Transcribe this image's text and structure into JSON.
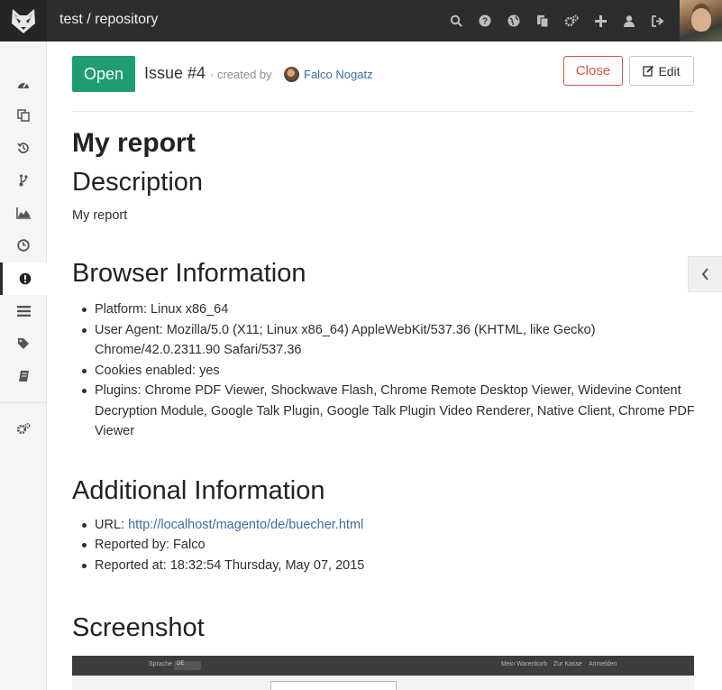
{
  "header": {
    "repo_title": "test / repository",
    "icons": [
      "search-icon",
      "help-icon",
      "globe-icon",
      "copy-icon",
      "cogs-icon",
      "plus-icon",
      "user-icon",
      "sign-out-icon"
    ]
  },
  "sidebar": {
    "items": [
      {
        "name": "dashboard-icon"
      },
      {
        "name": "files-icon"
      },
      {
        "name": "history-icon"
      },
      {
        "name": "branch-icon"
      },
      {
        "name": "graphs-icon"
      },
      {
        "name": "clock-icon"
      },
      {
        "name": "issues-icon",
        "active": true
      },
      {
        "name": "list-icon"
      },
      {
        "name": "tags-icon"
      },
      {
        "name": "wiki-icon"
      },
      {
        "name": "settings-icon"
      }
    ]
  },
  "issue": {
    "status": "Open",
    "number": "Issue #4",
    "created_by": "· created by",
    "author": "Falco Nogatz",
    "close_label": "Close",
    "edit_label": "Edit",
    "title": "My report"
  },
  "sections": {
    "description_heading": "Description",
    "description_text": "My report",
    "browser_heading": "Browser Information",
    "browser_items": [
      "Platform: Linux x86_64",
      "User Agent: Mozilla/5.0 (X11; Linux x86_64) AppleWebKit/537.36 (KHTML, like Gecko) Chrome/42.0.2311.90 Safari/537.36",
      "Cookies enabled: yes",
      "Plugins: Chrome PDF Viewer, Shockwave Flash, Chrome Remote Desktop Viewer, Widevine Content Decryption Module, Google Talk Plugin, Google Talk Plugin Video Renderer, Native Client, Chrome PDF Viewer"
    ],
    "additional_heading": "Additional Information",
    "url_label": "URL: ",
    "url_value": "http://localhost/magento/de/buecher.html",
    "reported_by": "Reported by: Falco",
    "reported_at": "Reported at: 18:32:54 Thursday, May 07, 2015",
    "screenshot_heading": "Screenshot"
  },
  "screenshot_thumb": {
    "language_label": "Sprache",
    "language_value": "DE",
    "cart": "Mein Warenkorb",
    "checkout": "Zur Kasse",
    "login": "Anmelden"
  },
  "colors": {
    "header_bg": "#2d2d2f",
    "open_badge": "#1f9d71",
    "close_button": "#d9534f",
    "link": "#3b6ea4"
  }
}
